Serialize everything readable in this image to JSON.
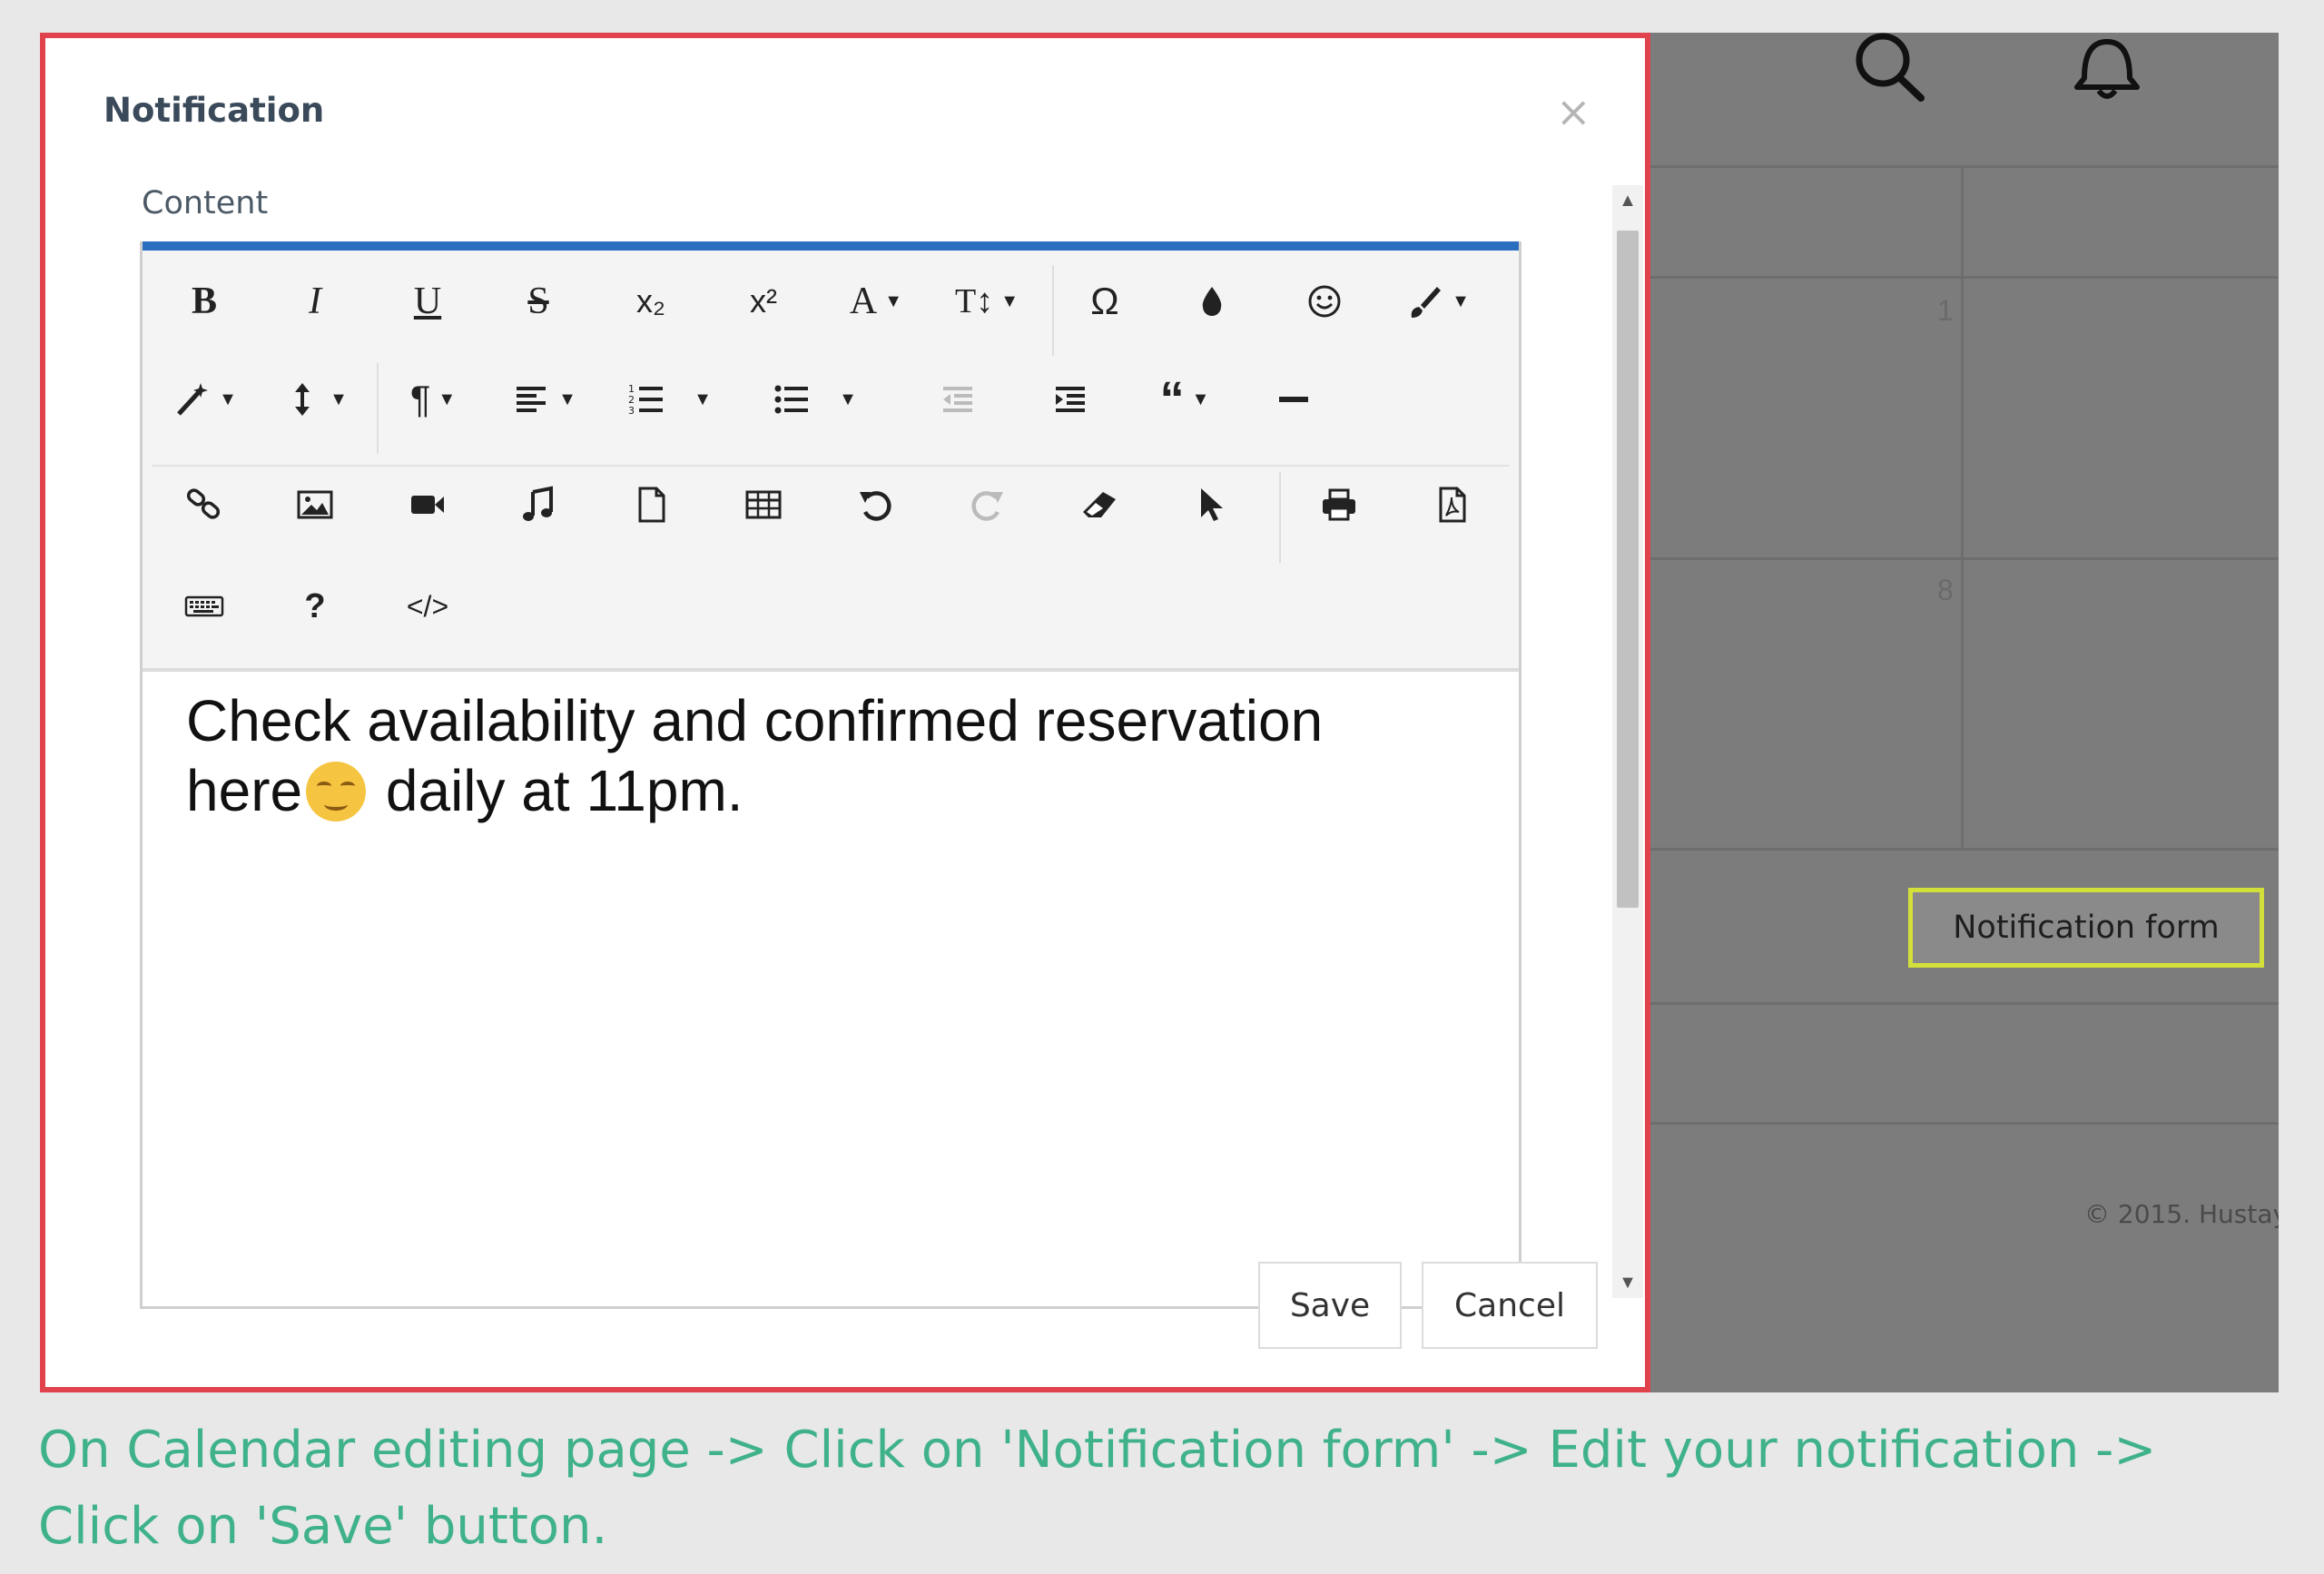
{
  "background": {
    "day_numbers": [
      "1",
      "8"
    ],
    "notification_form_button": "Notification form",
    "footer_text": "© 2015. Hustay"
  },
  "modal": {
    "title": "Notification",
    "close_glyph": "×",
    "field_label": "Content",
    "content_line1": "Check availability and confirmed reservation",
    "content_line2_a": "here",
    "content_line2_b": " daily at 11pm.",
    "save_label": "Save",
    "cancel_label": "Cancel"
  },
  "toolbar": {
    "bold": "B",
    "italic": "I",
    "underline": "U",
    "strikethrough": "S",
    "subscript": "x₂",
    "superscript": "x²",
    "font_family": "A",
    "font_size": "T↕",
    "special_char": "Ω",
    "help": "?",
    "code_view": "</>"
  },
  "caption": "On Calendar editing page -> Click on 'Notification form' -> Edit your notification -> Click on 'Save' button."
}
